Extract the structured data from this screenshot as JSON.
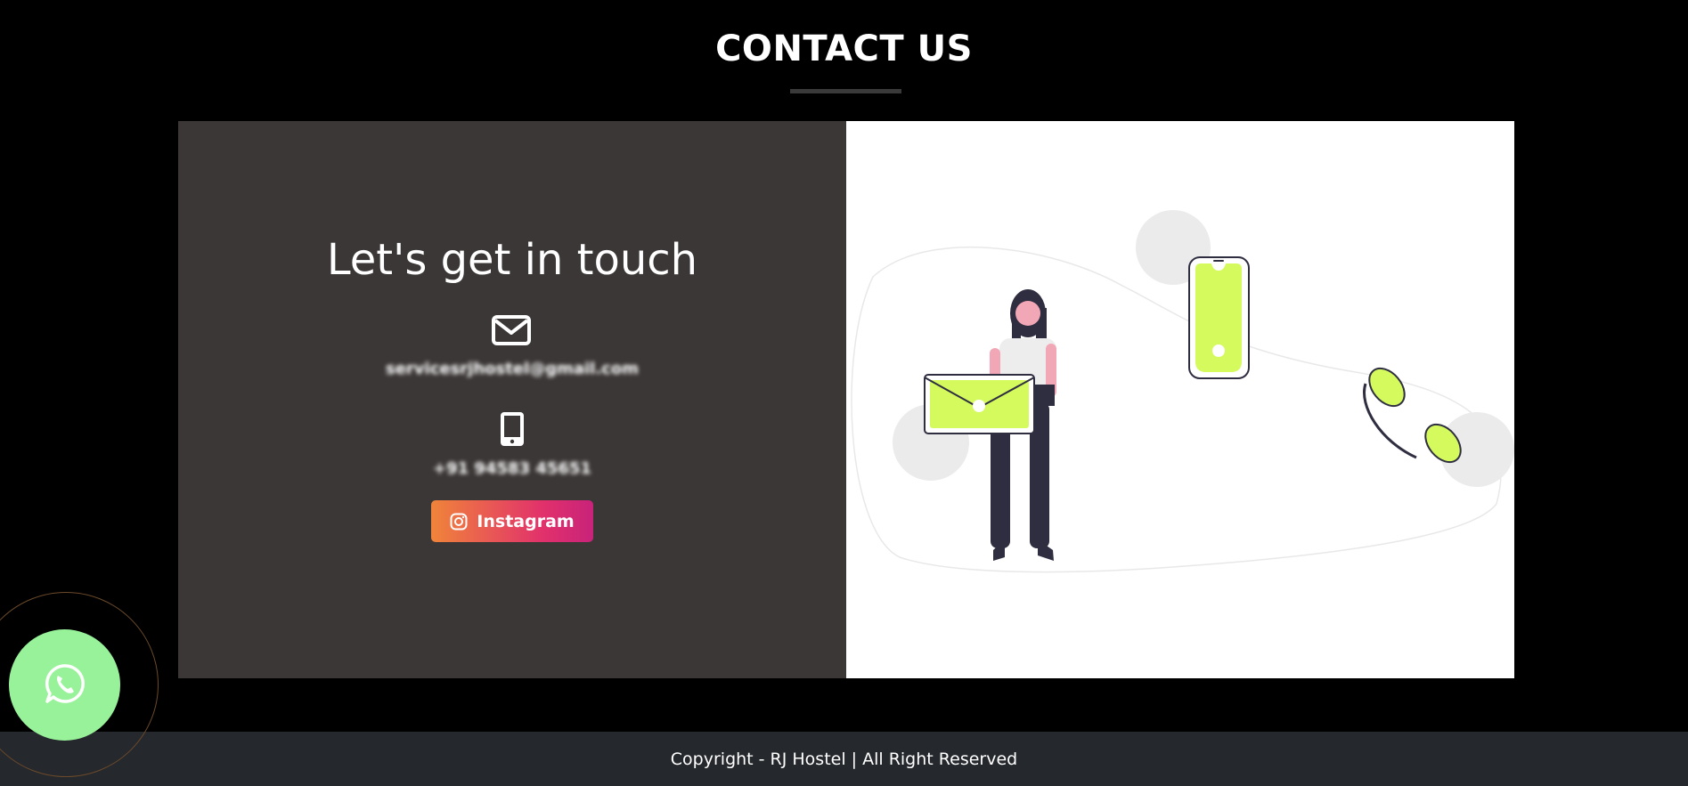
{
  "section": {
    "title": "CONTACT US"
  },
  "contact": {
    "heading": "Let's get in touch",
    "email": "servicesrjhostel@gmail.com",
    "phone": "+91 94583 45651",
    "instagram_label": "Instagram"
  },
  "footer": {
    "text": "Copyright - RJ Hostel | All Right Reserved"
  },
  "icons": {
    "email": "envelope-icon",
    "phone": "mobile-phone-icon",
    "instagram": "instagram-icon",
    "whatsapp": "whatsapp-icon"
  },
  "colors": {
    "accent": "#d4fa5e",
    "info_panel": "#3b3736",
    "footer": "#25282c",
    "whatsapp": "#98f29a",
    "instagram_gradient": [
      "#f0843a",
      "#e1306c"
    ]
  }
}
